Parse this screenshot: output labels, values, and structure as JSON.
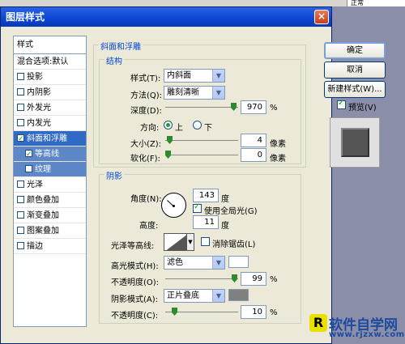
{
  "background": {
    "field_text": "正常"
  },
  "window": {
    "title": "图层样式",
    "close_glyph": "×"
  },
  "styles_list": {
    "header": "样式",
    "blend_item": "混合选项:默认",
    "items": [
      {
        "label": "投影",
        "checked": false
      },
      {
        "label": "内阴影",
        "checked": false
      },
      {
        "label": "外发光",
        "checked": false
      },
      {
        "label": "内发光",
        "checked": false
      },
      {
        "label": "斜面和浮雕",
        "checked": true
      },
      {
        "label": "等高线",
        "checked": true
      },
      {
        "label": "纹理",
        "checked": false
      },
      {
        "label": "光泽",
        "checked": false
      },
      {
        "label": "颜色叠加",
        "checked": false
      },
      {
        "label": "渐变叠加",
        "checked": false
      },
      {
        "label": "图案叠加",
        "checked": false
      },
      {
        "label": "描边",
        "checked": false
      }
    ]
  },
  "bevel": {
    "section_title": "斜面和浮雕",
    "structure_title": "结构",
    "style_label": "样式(T):",
    "style_value": "内斜面",
    "technique_label": "方法(Q):",
    "technique_value": "雕刻清晰",
    "depth_label": "深度(D):",
    "depth_value": "970",
    "depth_unit": "%",
    "depth_level": 0.97,
    "direction_label": "方向:",
    "direction_up": "上",
    "direction_down": "下",
    "size_label": "大小(Z):",
    "size_value": "4",
    "size_unit": "像素",
    "size_level": 0.02,
    "soften_label": "软化(F):",
    "soften_value": "0",
    "soften_unit": "像素",
    "soften_level": 0.0
  },
  "shading": {
    "title": "阴影",
    "angle_label": "角度(N):",
    "angle_value": "143",
    "angle_unit": "度",
    "global_light_label": "使用全局光(G)",
    "altitude_label": "高度:",
    "altitude_value": "11",
    "altitude_unit": "度",
    "gloss_contour_label": "光泽等高线:",
    "anti_alias_label": "消除锯齿(L)",
    "highlight_mode_label": "高光模式(H):",
    "highlight_mode_value": "滤色",
    "highlight_color": "#ffffff",
    "highlight_opacity_label": "不透明度(O):",
    "highlight_opacity_value": "99",
    "highlight_opacity_level": 0.99,
    "opacity_unit": "%",
    "shadow_mode_label": "阴影模式(A):",
    "shadow_mode_value": "正片叠底",
    "shadow_color": "#808080",
    "shadow_opacity_label": "不透明度(C):",
    "shadow_opacity_value": "10",
    "shadow_opacity_level": 0.1
  },
  "buttons": {
    "ok": "确定",
    "cancel": "取消",
    "new_style": "新建样式(W)...",
    "preview_label": "预览(V)"
  },
  "watermark": {
    "brand": "软件自学网",
    "url": "www.rjzxw.com",
    "icon_letter": "R"
  }
}
